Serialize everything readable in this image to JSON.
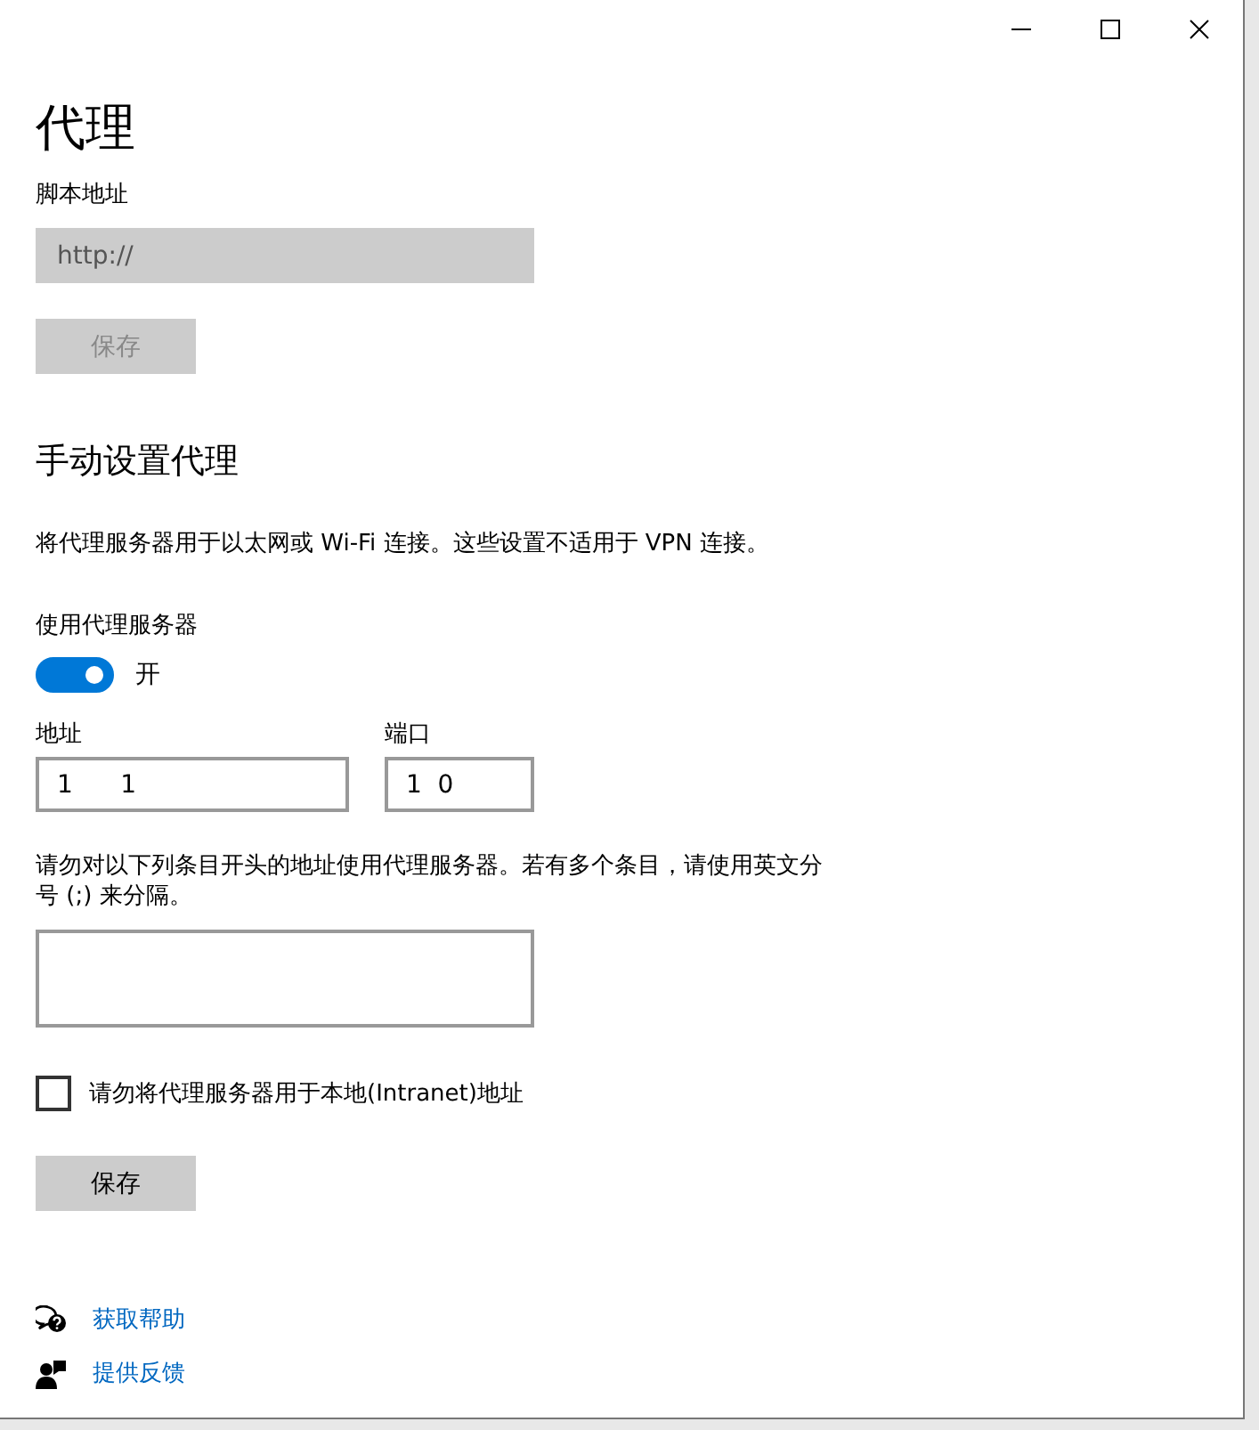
{
  "window": {
    "controls": [
      {
        "kind": "minimize"
      },
      {
        "kind": "maximize"
      },
      {
        "kind": "close"
      }
    ]
  },
  "title": "代理",
  "script_section": {
    "label": "脚本地址",
    "field": {
      "value": "http://"
    },
    "save_button": {
      "label": "保存",
      "disabled": true
    }
  },
  "manual_section": {
    "heading": "手动设置代理",
    "description": "将代理服务器用于以太网或 Wi-Fi 连接。这些设置不适用于 VPN 连接。",
    "use_proxy": {
      "label": "使用代理服务器",
      "on": true,
      "state_text": "开"
    },
    "address": {
      "label": "地址",
      "value": "1      1"
    },
    "port": {
      "label": "端口",
      "value": "1  0"
    },
    "exceptions_label": "请勿对以下列条目开头的地址使用代理服务器。若有多个条目，请使用英文分号 (;) 来分隔。",
    "local_bypass": {
      "label": "请勿将代理服务器用于本地(Intranet)地址",
      "checked": false
    },
    "save_button": {
      "label": "保存",
      "disabled": false
    }
  },
  "links": [
    {
      "kind": "help",
      "label": "获取帮助"
    },
    {
      "kind": "feedback",
      "label": "提供反馈"
    }
  ]
}
